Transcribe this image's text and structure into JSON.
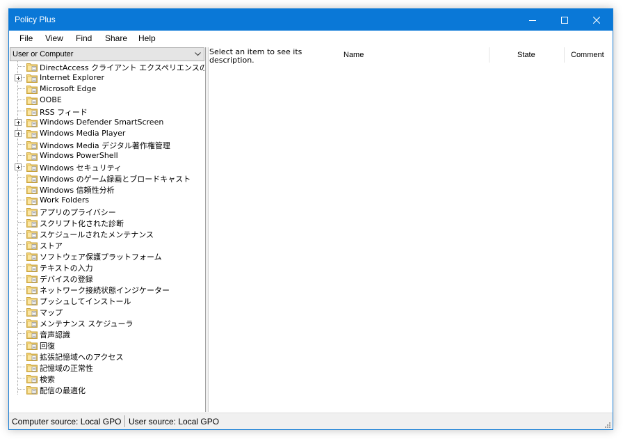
{
  "window": {
    "title": "Policy Plus",
    "accent_color": "#0a78d7"
  },
  "menu": [
    "File",
    "View",
    "Find",
    "Share",
    "Help"
  ],
  "left_pane": {
    "combo_value": "User or Computer",
    "tree": [
      {
        "label": "DirectAccess クライアント エクスペリエンスの設定",
        "expandable": false
      },
      {
        "label": "Internet Explorer",
        "expandable": true
      },
      {
        "label": "Microsoft Edge",
        "expandable": false
      },
      {
        "label": "OOBE",
        "expandable": false
      },
      {
        "label": "RSS フィード",
        "expandable": false
      },
      {
        "label": "Windows Defender SmartScreen",
        "expandable": true
      },
      {
        "label": "Windows Media Player",
        "expandable": true
      },
      {
        "label": "Windows Media デジタル著作権管理",
        "expandable": false
      },
      {
        "label": "Windows PowerShell",
        "expandable": false
      },
      {
        "label": "Windows セキュリティ",
        "expandable": true
      },
      {
        "label": "Windows のゲーム録画とブロードキャスト",
        "expandable": false
      },
      {
        "label": "Windows 信頼性分析",
        "expandable": false
      },
      {
        "label": "Work Folders",
        "expandable": false
      },
      {
        "label": "アプリのプライバシー",
        "expandable": false
      },
      {
        "label": "スクリプト化された診断",
        "expandable": false
      },
      {
        "label": "スケジュールされたメンテナンス",
        "expandable": false
      },
      {
        "label": "ストア",
        "expandable": false
      },
      {
        "label": "ソフトウェア保護プラットフォーム",
        "expandable": false
      },
      {
        "label": "テキストの入力",
        "expandable": false
      },
      {
        "label": "デバイスの登録",
        "expandable": false
      },
      {
        "label": "ネットワーク接続状態インジケーター",
        "expandable": false
      },
      {
        "label": "プッシュしてインストール",
        "expandable": false
      },
      {
        "label": "マップ",
        "expandable": false
      },
      {
        "label": "メンテナンス スケジューラ",
        "expandable": false
      },
      {
        "label": "音声認識",
        "expandable": false
      },
      {
        "label": "回復",
        "expandable": false
      },
      {
        "label": "拡張記憶域へのアクセス",
        "expandable": false
      },
      {
        "label": "記憶域の正常性",
        "expandable": false
      },
      {
        "label": "検索",
        "expandable": false
      },
      {
        "label": "配信の最適化",
        "expandable": false
      }
    ]
  },
  "right_pane": {
    "description": "Select an item to see its description.",
    "columns": {
      "name": "Name",
      "state": "State",
      "comment": "Comment"
    }
  },
  "status": {
    "computer_source": "Computer source:  Local GPO",
    "user_source": "User source:  Local GPO"
  },
  "icons": {
    "folder": "folder-policy-icon",
    "expander": "plus-expander-icon"
  }
}
